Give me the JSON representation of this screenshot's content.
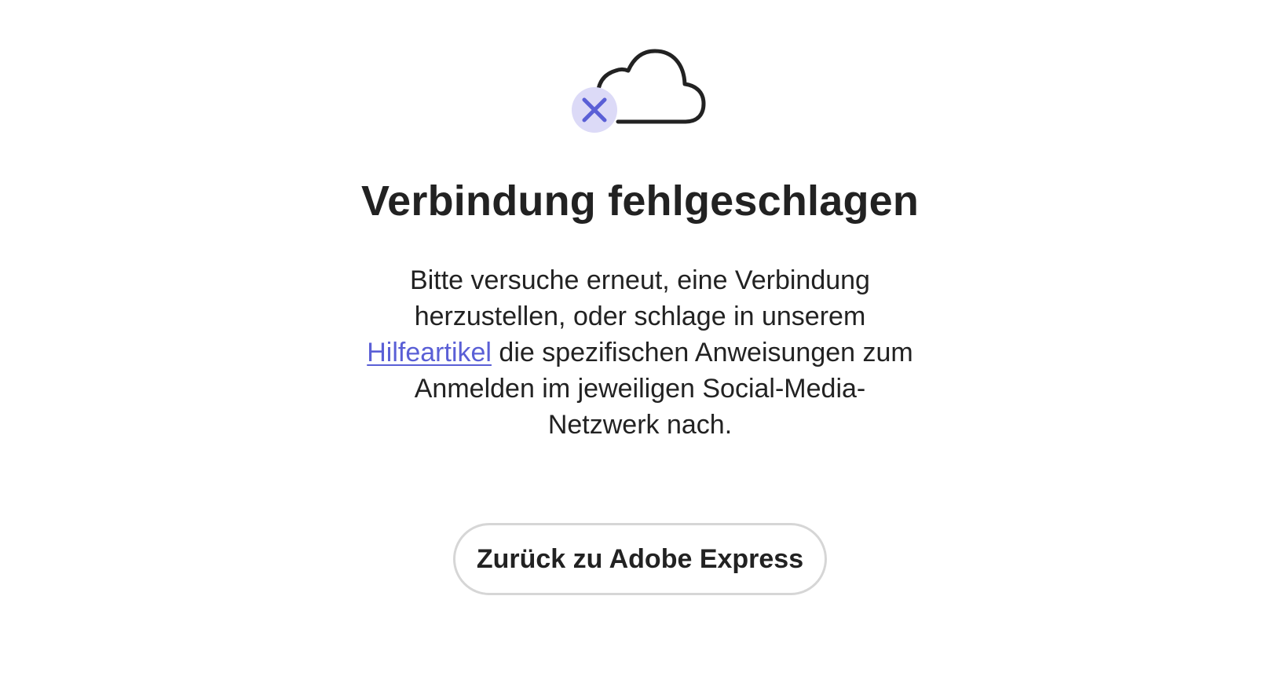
{
  "illustration": {
    "icon": "cloud-icon",
    "badge_icon": "close-icon",
    "badge_color": "#dcdaf7",
    "badge_mark_color": "#5a5fd6"
  },
  "error": {
    "title": "Verbindung fehlgeschlagen",
    "message_before_link": "Bitte versuche erneut, eine Verbindung herzustellen, oder schlage in unserem ",
    "link_text": "Hilfeartikel",
    "message_after_link": " die spezifischen Anweisungen zum Anmelden im jeweiligen Social-Media-Netzwerk nach."
  },
  "actions": {
    "back_label": "Zurück zu Adobe Express"
  },
  "colors": {
    "link": "#5a5fd6",
    "text": "#222222",
    "button_border": "#d6d6d6"
  }
}
